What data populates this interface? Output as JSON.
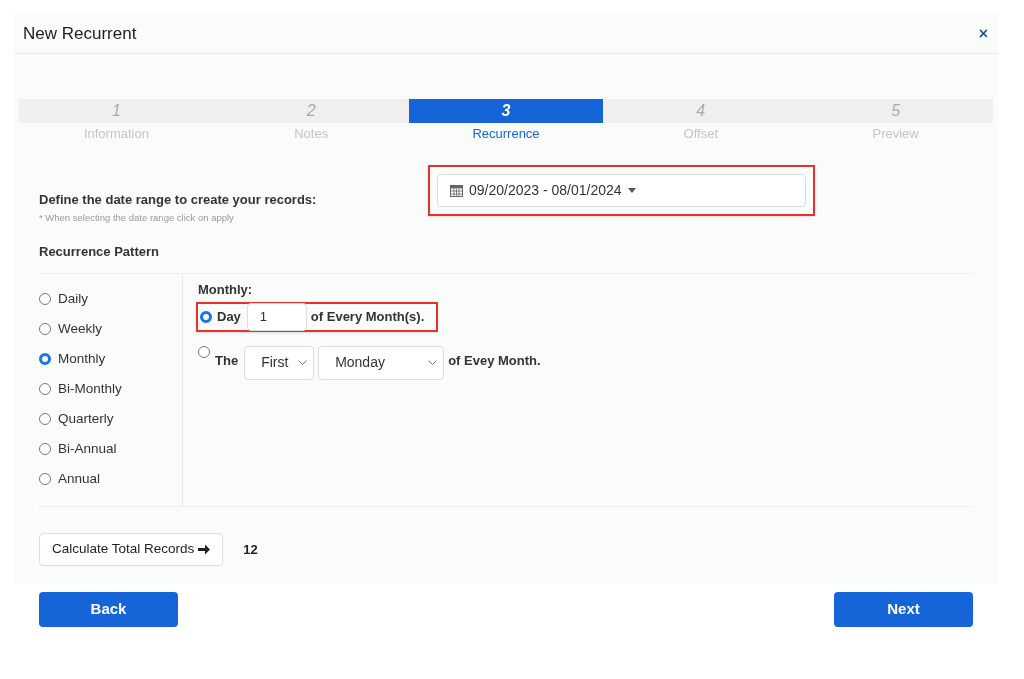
{
  "window": {
    "title": "New Recurrent",
    "close": "×"
  },
  "steps": [
    {
      "number": "1",
      "label": "Information",
      "selected": false
    },
    {
      "number": "2",
      "label": "Notes",
      "selected": false
    },
    {
      "number": "3",
      "label": "Recurrence",
      "selected": true
    },
    {
      "number": "4",
      "label": "Offset",
      "selected": false
    },
    {
      "number": "5",
      "label": "Preview",
      "selected": false
    }
  ],
  "date_range": {
    "label": "Define the date range to create your records:",
    "hint": "* When selecting the date range click on apply",
    "value": "09/20/2023 - 08/01/2024",
    "highlighted": true
  },
  "pattern": {
    "title": "Recurrence Pattern",
    "options": [
      {
        "label": "Daily",
        "selected": false
      },
      {
        "label": "Weekly",
        "selected": false
      },
      {
        "label": "Monthly",
        "selected": true
      },
      {
        "label": "Bi-Monthly",
        "selected": false
      },
      {
        "label": "Quarterly",
        "selected": false
      },
      {
        "label": "Bi-Annual",
        "selected": false
      },
      {
        "label": "Annual",
        "selected": false
      }
    ]
  },
  "monthly": {
    "title": "Monthly:",
    "day_option": {
      "selected": true,
      "highlighted": true,
      "label": "Day",
      "value": "1",
      "suffix": "of Every Month(s)."
    },
    "the_option": {
      "selected": false,
      "label": "The",
      "ordinal": "First",
      "weekday": "Monday",
      "suffix": "of Evey Month."
    }
  },
  "calculate": {
    "button": "Calculate Total Records",
    "total": "12"
  },
  "buttons": {
    "back": "Back",
    "next": "Next"
  }
}
